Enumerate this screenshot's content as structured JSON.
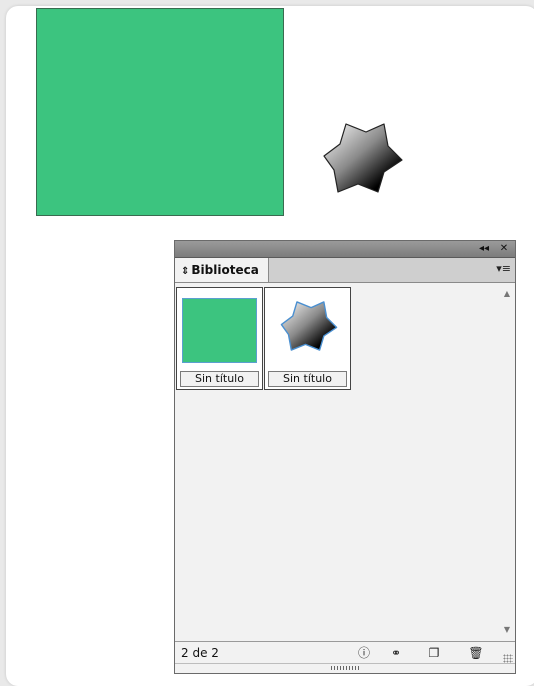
{
  "colors": {
    "green_rect": "#3cc47f",
    "panel_bg": "#f2f2f2"
  },
  "panel": {
    "title": "Biblioteca",
    "tab_arrows_icon": "updown-arrows-icon",
    "titlebar": {
      "collapse_icon": "double-chevron-left-icon",
      "close_icon": "close-icon"
    },
    "menu_icon": "panel-menu-icon",
    "items": [
      {
        "caption": "Sin título",
        "thumb": "green-rectangle"
      },
      {
        "caption": "Sin título",
        "thumb": "gradient-star"
      }
    ],
    "status": "2 de 2",
    "footer_icons": [
      "info-icon",
      "binoculars-icon",
      "new-item-icon",
      "trash-icon"
    ]
  },
  "glyphs": {
    "collapse": "◂◂",
    "close": "✕",
    "tab_arrows": "⇕",
    "menu": "▾≡",
    "scroll_up": "▲",
    "scroll_down": "▼",
    "info": "ⓘ",
    "binoculars": "⚭",
    "new_item": "❐",
    "trash": "🗑"
  }
}
